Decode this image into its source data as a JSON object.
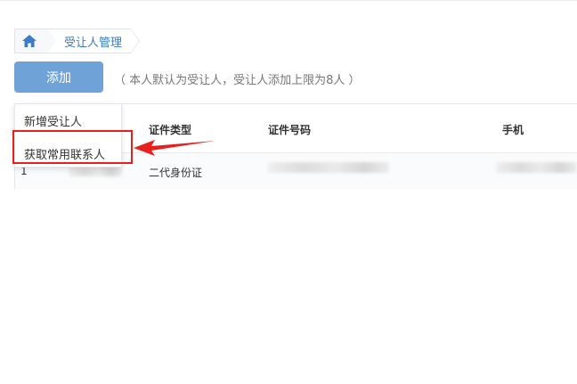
{
  "breadcrumb": {
    "home_icon": "home-icon",
    "current": "受让人管理"
  },
  "toolbar": {
    "add_label": "添加",
    "hint": "（ 本人默认为受让人，受让人添加上限为8人 ）"
  },
  "dropdown": {
    "items": [
      {
        "label": "新增受让人"
      },
      {
        "label": "获取常用联系人"
      }
    ]
  },
  "table": {
    "columns": [
      "证件类型",
      "证件号码",
      "手机"
    ],
    "rows": [
      {
        "index": "1",
        "id_type": "二代身份证"
      }
    ]
  },
  "colors": {
    "accent": "#6fa3d8",
    "link": "#3a7cc7",
    "highlight": "#e8201c"
  }
}
